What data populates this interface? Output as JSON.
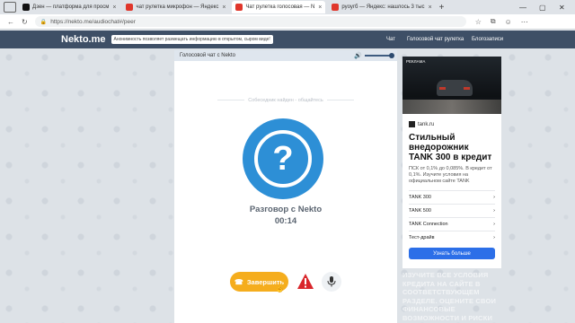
{
  "browser": {
    "tabs": [
      {
        "label": "Дзен — платформа для просм",
        "favicon_color": "#111111",
        "active": false
      },
      {
        "label": "чат рулетка микрофон — Яндекс",
        "favicon_color": "#e0362b",
        "active": false
      },
      {
        "label": "Чат рулетка голосовая — N",
        "favicon_color": "#e0362b",
        "active": true
      },
      {
        "label": "руоугб — Яндекс: нашлось 3 тыс",
        "favicon_color": "#e0362b",
        "active": false
      }
    ],
    "url": "https://nekto.me/audiochat#/peer"
  },
  "site": {
    "logo": "Nekto.me",
    "anon_notice": "Анонимность позволяет размещать информацию в открытом, сыром виде!",
    "nav": [
      "Чат",
      "Голосовой чат рулетка",
      "Блогозаписи"
    ]
  },
  "chat": {
    "panel_title": "Голосовой чат с Nekto",
    "volume_level": 1.0,
    "found_text": "Собеседник найден - общайтесь",
    "avatar_symbol": "?",
    "conversation_title": "Разговор с Nekto",
    "timer": "00:14",
    "end_button": "Завершить"
  },
  "ad": {
    "label": "РЕКЛАМА",
    "brand": "tank.ru",
    "title": "Стильный внедорожник TANK 300 в кредит",
    "text": "ПСК от 0,1% до 0,085%. В кредит от 0,1%. Изучите условия на официальном сайте TANK",
    "links": [
      "TANK 300",
      "TANK 500",
      "TANK Connection",
      "Тест-драйв"
    ],
    "cta": "Узнать больше",
    "disclaimer": "Изучите все условия кредита на сайте в соответствующем разделе. Оцените свои финансовые возможности и риски"
  },
  "colors": {
    "header": "#3e4f66",
    "avatar": "#2d8fd6",
    "end_button": "#f5ad1d",
    "cta": "#2c6fe8"
  }
}
